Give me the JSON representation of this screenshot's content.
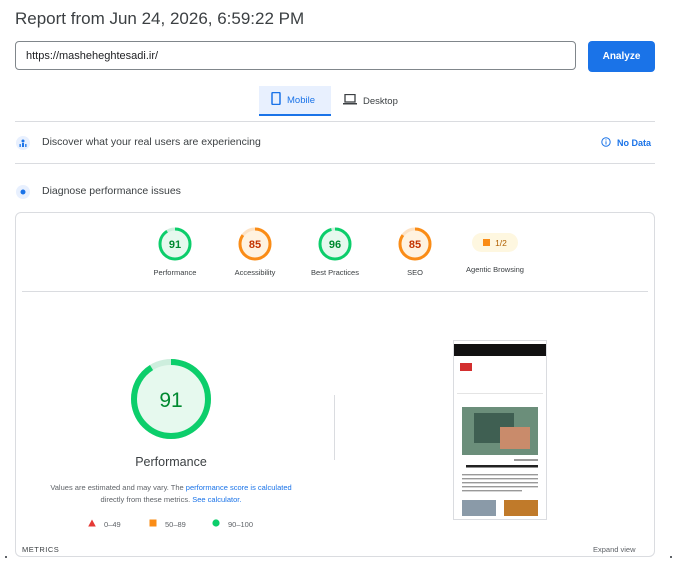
{
  "report": {
    "title": "Report from Jun 24, 2026, 6:59:22 PM"
  },
  "search": {
    "url_value": "https://masheheghtesadi.ir/",
    "analyze_label": "Analyze"
  },
  "tabs": [
    {
      "label": "Mobile",
      "icon": "smartphone-icon",
      "active": true
    },
    {
      "label": "Desktop",
      "icon": "laptop-icon",
      "active": false
    }
  ],
  "crux": {
    "title": "Discover what your real users are experiencing",
    "status": "No Data",
    "icon": "people-icon"
  },
  "diagnose": {
    "title": "Diagnose performance issues",
    "icon": "performance-icon"
  },
  "categories": [
    {
      "label": "Performance",
      "score": 91,
      "status": "pass"
    },
    {
      "label": "Accessibility",
      "score": 85,
      "status": "average"
    },
    {
      "label": "Best Practices",
      "score": 96,
      "status": "pass"
    },
    {
      "label": "SEO",
      "score": 85,
      "status": "average"
    },
    {
      "label": "Agentic Browsing",
      "score_text": "1/2",
      "status": "average"
    }
  ],
  "performance_detail": {
    "score": 91,
    "label": "Performance",
    "note_prefix": "Values are estimated and may vary. The ",
    "note_link1": "performance score is calculated",
    "note_middle": "directly from these metrics. ",
    "note_link2": "See calculator."
  },
  "legend": [
    {
      "range": "0–49",
      "shape": "triangle",
      "color": "#e53935"
    },
    {
      "range": "50–89",
      "shape": "square",
      "color": "#fa8c16"
    },
    {
      "range": "90–100",
      "shape": "circle",
      "color": "#0cce6b"
    }
  ],
  "colors": {
    "pass": "#0cce6b",
    "pass_text": "#008a30",
    "average": "#fa8c16",
    "average_text": "#c33300",
    "accent": "#1a73e8"
  },
  "metrics": {
    "label": "METRICS",
    "expand_label": "Expand view"
  }
}
